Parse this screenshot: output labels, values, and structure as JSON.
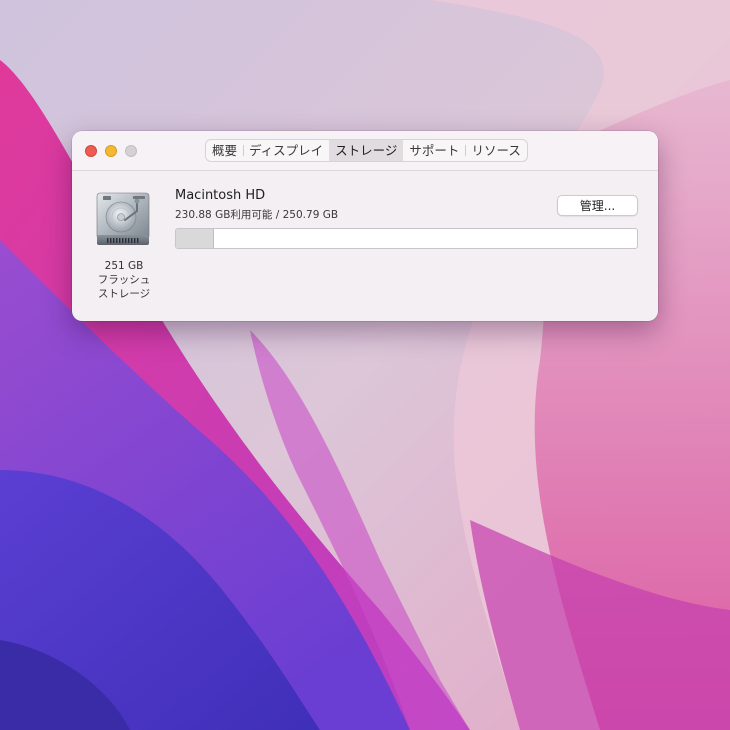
{
  "window": {
    "tabs": [
      {
        "label": "概要",
        "selected": false
      },
      {
        "label": "ディスプレイ",
        "selected": false
      },
      {
        "label": "ストレージ",
        "selected": true
      },
      {
        "label": "サポート",
        "selected": false
      },
      {
        "label": "リソース",
        "selected": false
      }
    ]
  },
  "disk": {
    "icon": "hard-drive-icon",
    "caption_line1": "251 GB",
    "caption_line2": "フラッシュ",
    "caption_line3": "ストレージ"
  },
  "volume": {
    "name": "Macintosh HD",
    "space_text": "230.88 GB利用可能 / 250.79 GB",
    "available_gb": 230.88,
    "total_gb": 250.79,
    "manage_label": "管理..."
  },
  "colors": {
    "close": "#ee5b52",
    "minimize": "#f5b833",
    "zoom_disabled": "#d5d1d4"
  }
}
